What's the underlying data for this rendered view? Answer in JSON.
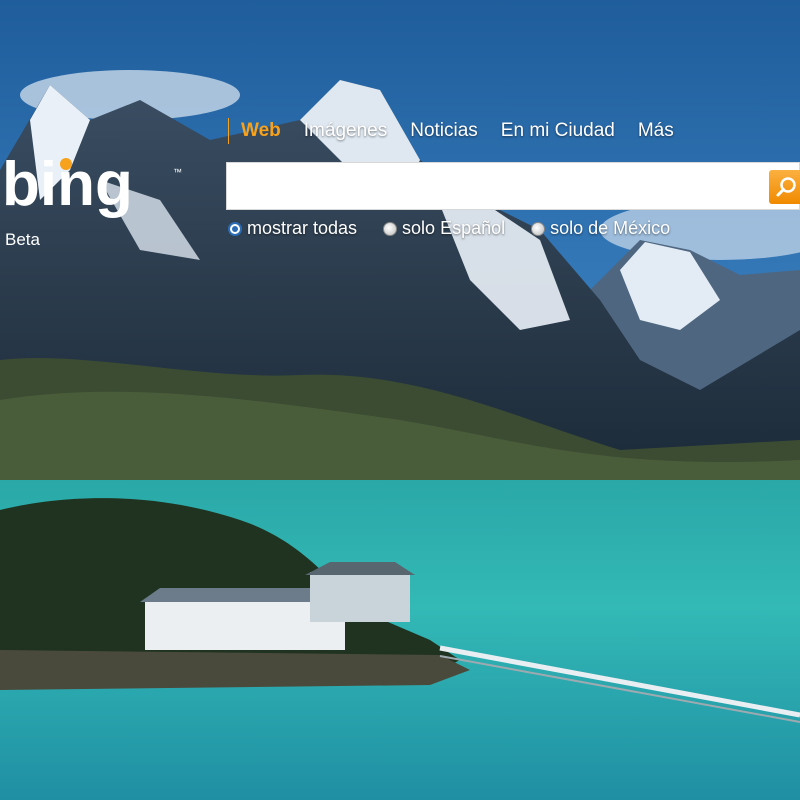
{
  "brand": {
    "logo_text": "bing",
    "beta_label": "Beta"
  },
  "nav": {
    "items": [
      {
        "label": "Web",
        "active": true
      },
      {
        "label": "Imágenes"
      },
      {
        "label": "Noticias"
      },
      {
        "label": "En mi Ciudad"
      },
      {
        "label": "Más"
      }
    ]
  },
  "search": {
    "value": "",
    "placeholder": "",
    "button_icon": "search-icon"
  },
  "scope": {
    "options": [
      {
        "label": "mostrar todas",
        "selected": true
      },
      {
        "label": "solo Español",
        "selected": false
      },
      {
        "label": "solo de México",
        "selected": false
      }
    ]
  },
  "colors": {
    "accent": "#f7a21c",
    "sky": "#2a6fb0",
    "lake": "#2fb5b0"
  }
}
